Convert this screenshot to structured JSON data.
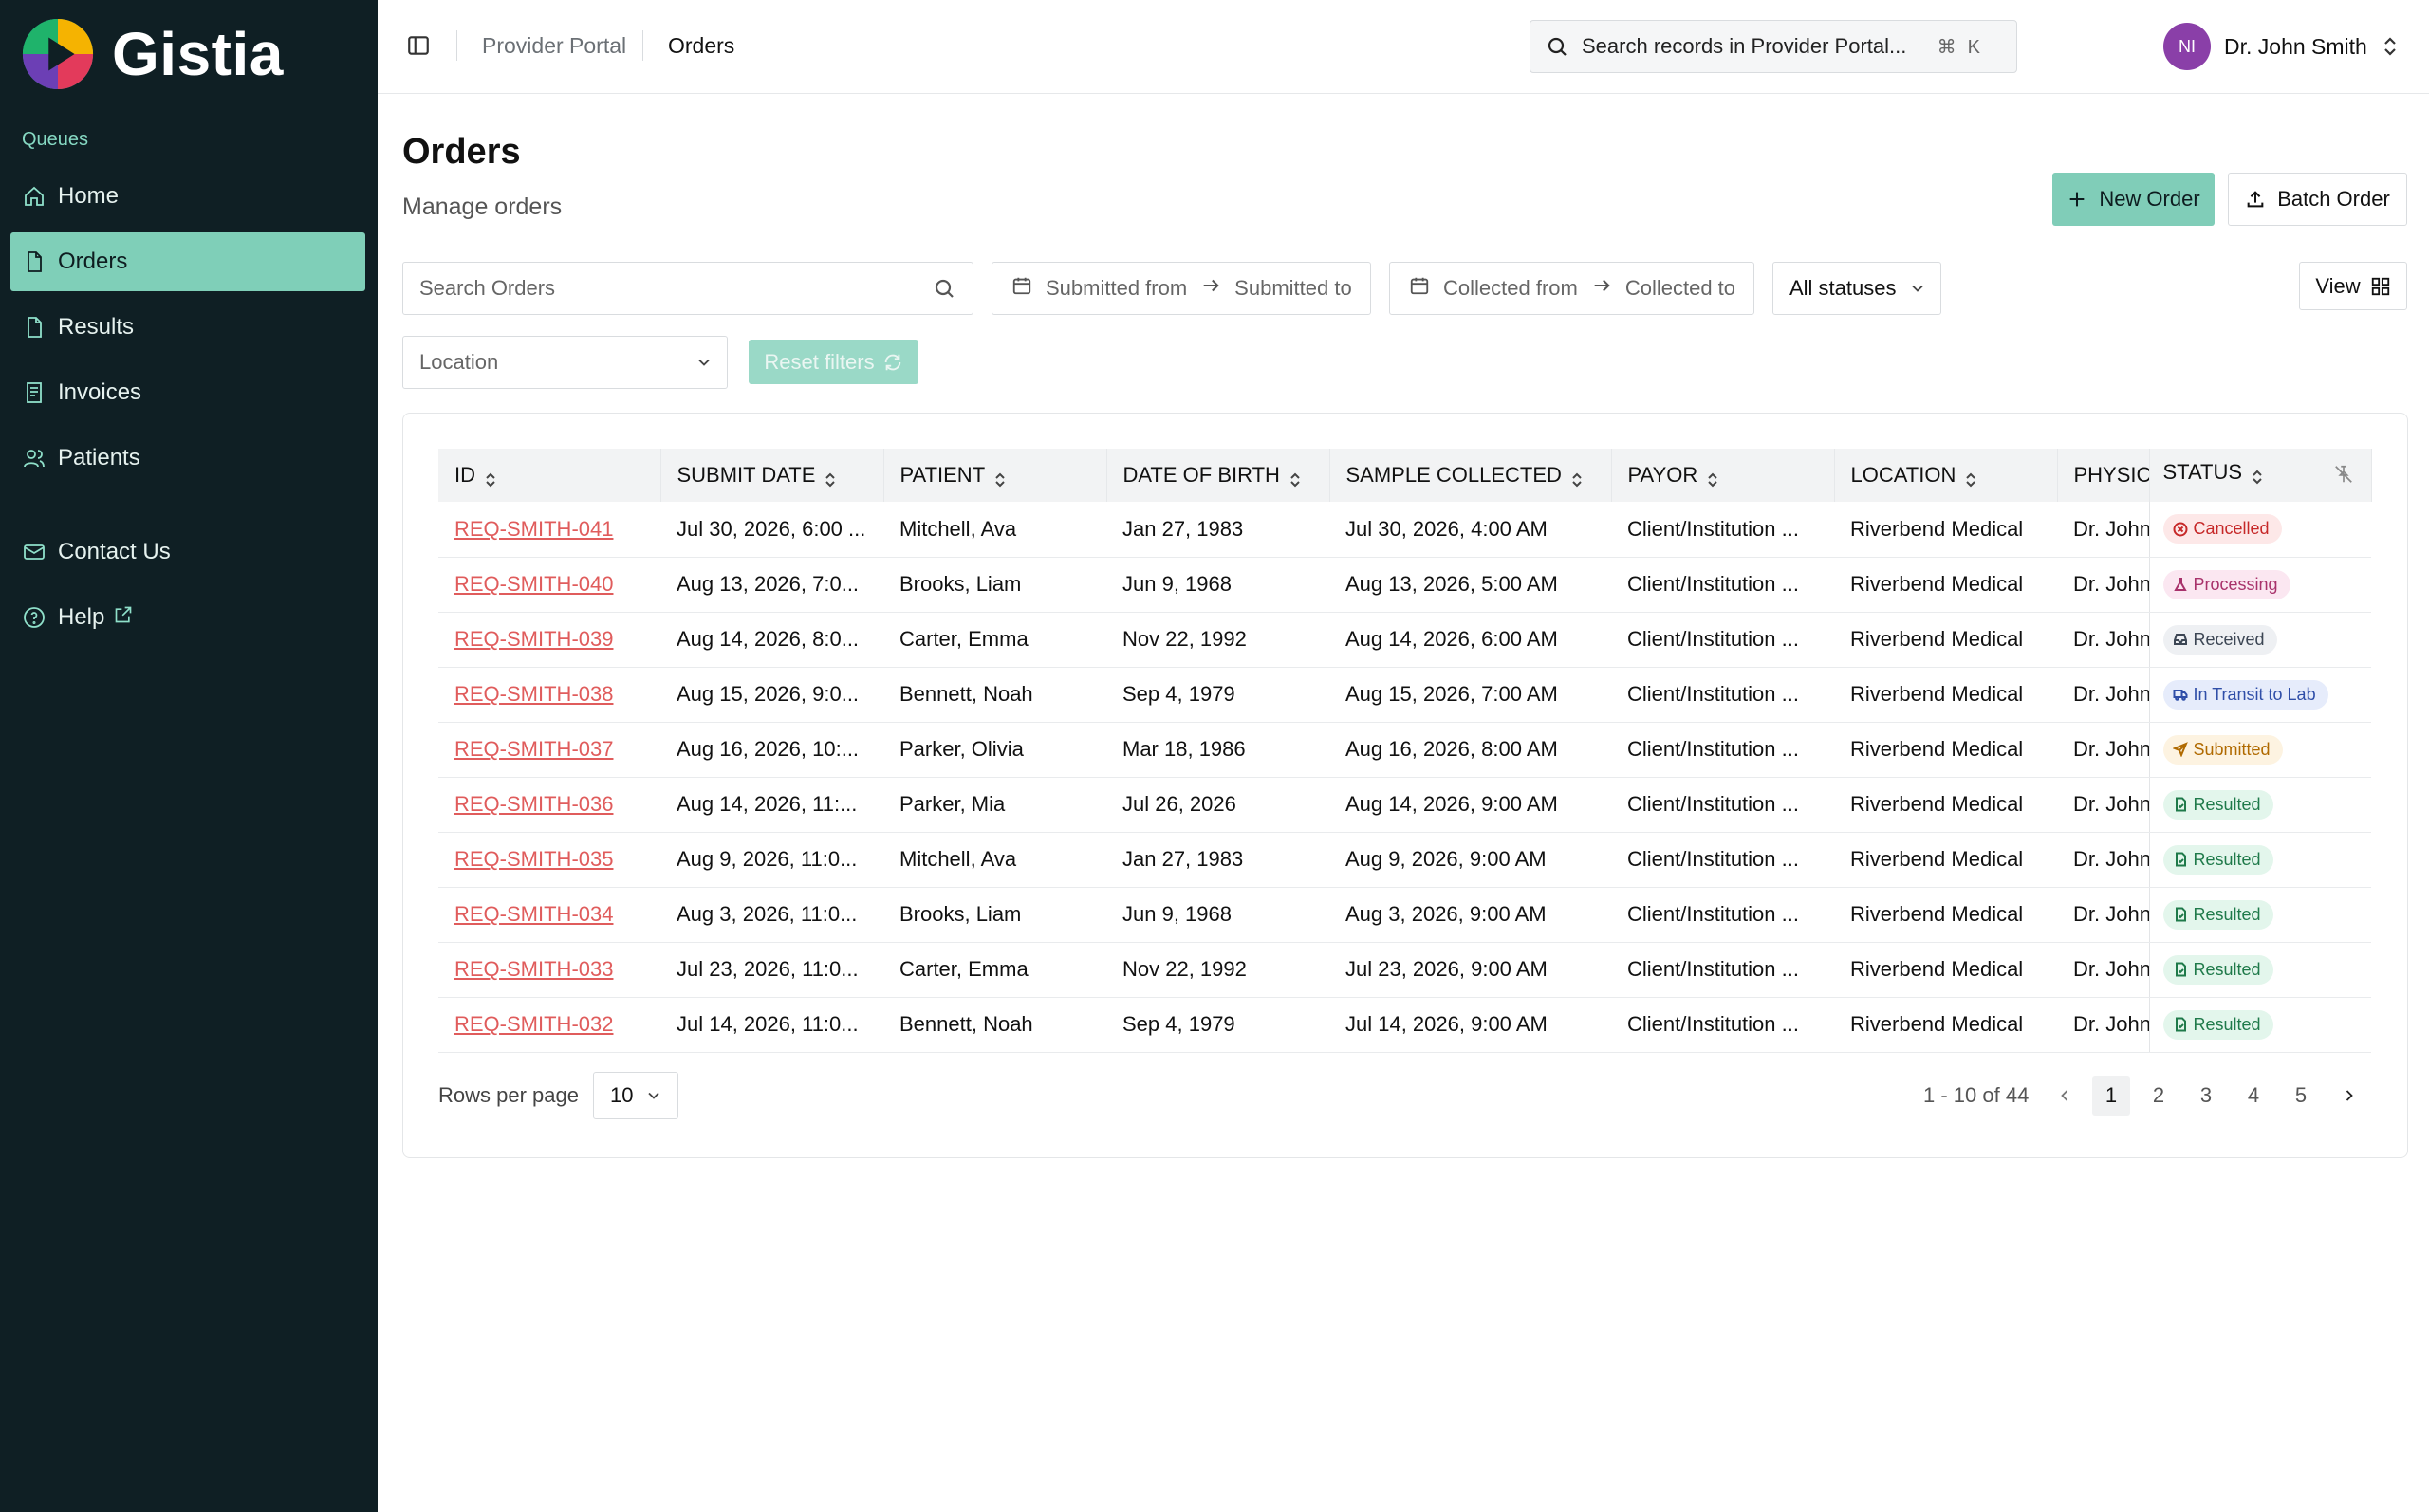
{
  "app": {
    "name": "Gistia"
  },
  "sidebar": {
    "section_label": "Queues",
    "items": [
      {
        "label": "Home",
        "icon": "home-icon"
      },
      {
        "label": "Orders",
        "icon": "file-icon",
        "active": true
      },
      {
        "label": "Results",
        "icon": "file-check-icon"
      },
      {
        "label": "Invoices",
        "icon": "receipt-icon"
      },
      {
        "label": "Patients",
        "icon": "users-icon"
      }
    ],
    "footer_items": [
      {
        "label": "Contact Us",
        "icon": "mail-icon"
      },
      {
        "label": "Help",
        "icon": "help-circle-icon",
        "external": true
      }
    ]
  },
  "topbar": {
    "breadcrumb": [
      "Provider Portal",
      "Orders"
    ],
    "search_placeholder": "Search records in Provider Portal...",
    "shortcut": "⌘K",
    "user": {
      "initials": "NI",
      "name": "Dr. John Smith"
    }
  },
  "page": {
    "title": "Orders",
    "subtitle": "Manage orders",
    "new_order_label": "New Order",
    "batch_order_label": "Batch Order"
  },
  "filters": {
    "search_placeholder": "Search Orders",
    "submitted_from": "Submitted from",
    "submitted_to": "Submitted to",
    "collected_from": "Collected from",
    "collected_to": "Collected to",
    "status": "All statuses",
    "location": "Location",
    "reset_label": "Reset filters",
    "view_label": "View"
  },
  "table": {
    "columns": [
      "ID",
      "SUBMIT DATE",
      "PATIENT",
      "DATE OF BIRTH",
      "SAMPLE COLLECTED",
      "PAYOR",
      "LOCATION",
      "PHYSICIAN",
      "STATUS"
    ],
    "rows": [
      {
        "id": "REQ-SMITH-041",
        "submit": "Jul 30, 2026, 6:00 ...",
        "patient": "Mitchell, Ava",
        "dob": "Jan 27, 1983",
        "collected": "Jul 30, 2026, 4:00 AM",
        "payor": "Client/Institution ...",
        "location": "Riverbend Medical",
        "physician": "Dr. John Smith",
        "status": "Cancelled"
      },
      {
        "id": "REQ-SMITH-040",
        "submit": "Aug 13, 2026, 7:0...",
        "patient": "Brooks, Liam",
        "dob": "Jun 9, 1968",
        "collected": "Aug 13, 2026, 5:00 AM",
        "payor": "Client/Institution ...",
        "location": "Riverbend Medical",
        "physician": "Dr. John Smith",
        "status": "Processing"
      },
      {
        "id": "REQ-SMITH-039",
        "submit": "Aug 14, 2026, 8:0...",
        "patient": "Carter, Emma",
        "dob": "Nov 22, 1992",
        "collected": "Aug 14, 2026, 6:00 AM",
        "payor": "Client/Institution ...",
        "location": "Riverbend Medical",
        "physician": "Dr. John Smith",
        "status": "Received"
      },
      {
        "id": "REQ-SMITH-038",
        "submit": "Aug 15, 2026, 9:0...",
        "patient": "Bennett, Noah",
        "dob": "Sep 4, 1979",
        "collected": "Aug 15, 2026, 7:00 AM",
        "payor": "Client/Institution ...",
        "location": "Riverbend Medical",
        "physician": "Dr. John Smith",
        "status": "In Transit to Lab"
      },
      {
        "id": "REQ-SMITH-037",
        "submit": "Aug 16, 2026, 10:...",
        "patient": "Parker, Olivia",
        "dob": "Mar 18, 1986",
        "collected": "Aug 16, 2026, 8:00 AM",
        "payor": "Client/Institution ...",
        "location": "Riverbend Medical",
        "physician": "Dr. John Smith",
        "status": "Submitted"
      },
      {
        "id": "REQ-SMITH-036",
        "submit": "Aug 14, 2026, 11:...",
        "patient": "Parker, Mia",
        "dob": "Jul 26, 2026",
        "collected": "Aug 14, 2026, 9:00 AM",
        "payor": "Client/Institution ...",
        "location": "Riverbend Medical",
        "physician": "Dr. John Smith",
        "status": "Resulted"
      },
      {
        "id": "REQ-SMITH-035",
        "submit": "Aug 9, 2026, 11:0...",
        "patient": "Mitchell, Ava",
        "dob": "Jan 27, 1983",
        "collected": "Aug 9, 2026, 9:00 AM",
        "payor": "Client/Institution ...",
        "location": "Riverbend Medical",
        "physician": "Dr. John Smith",
        "status": "Resulted"
      },
      {
        "id": "REQ-SMITH-034",
        "submit": "Aug 3, 2026, 11:0...",
        "patient": "Brooks, Liam",
        "dob": "Jun 9, 1968",
        "collected": "Aug 3, 2026, 9:00 AM",
        "payor": "Client/Institution ...",
        "location": "Riverbend Medical",
        "physician": "Dr. John Smith",
        "status": "Resulted"
      },
      {
        "id": "REQ-SMITH-033",
        "submit": "Jul 23, 2026, 11:0...",
        "patient": "Carter, Emma",
        "dob": "Nov 22, 1992",
        "collected": "Jul 23, 2026, 9:00 AM",
        "payor": "Client/Institution ...",
        "location": "Riverbend Medical",
        "physician": "Dr. John Smith",
        "status": "Resulted"
      },
      {
        "id": "REQ-SMITH-032",
        "submit": "Jul 14, 2026, 11:0...",
        "patient": "Bennett, Noah",
        "dob": "Sep 4, 1979",
        "collected": "Jul 14, 2026, 9:00 AM",
        "payor": "Client/Institution ...",
        "location": "Riverbend Medical",
        "physician": "Dr. John Smith",
        "status": "Resulted"
      }
    ]
  },
  "status_styles": {
    "Cancelled": {
      "bg": "#fde8e8",
      "fg": "#c62828",
      "icon": "x-circle-icon"
    },
    "Processing": {
      "bg": "#fbe7f1",
      "fg": "#a8326b",
      "icon": "flask-icon"
    },
    "Received": {
      "bg": "#eef0f3",
      "fg": "#3c4654",
      "icon": "inbox-icon"
    },
    "In Transit to Lab": {
      "bg": "#e6ecfb",
      "fg": "#2f4ea8",
      "icon": "truck-icon"
    },
    "Submitted": {
      "bg": "#fdf3e1",
      "fg": "#b06a00",
      "icon": "send-icon"
    },
    "Resulted": {
      "bg": "#e3f6ec",
      "fg": "#1f7a4a",
      "icon": "file-check-icon"
    }
  },
  "pagination": {
    "rows_per_page_label": "Rows per page",
    "rows_per_page": "10",
    "range": "1 - 10 of 44",
    "pages": [
      "1",
      "2",
      "3",
      "4",
      "5"
    ],
    "current_page": "1"
  },
  "colors": {
    "sidebar_bg": "#0f1f24",
    "accent": "#80cdb8",
    "link": "#e05c5c"
  }
}
